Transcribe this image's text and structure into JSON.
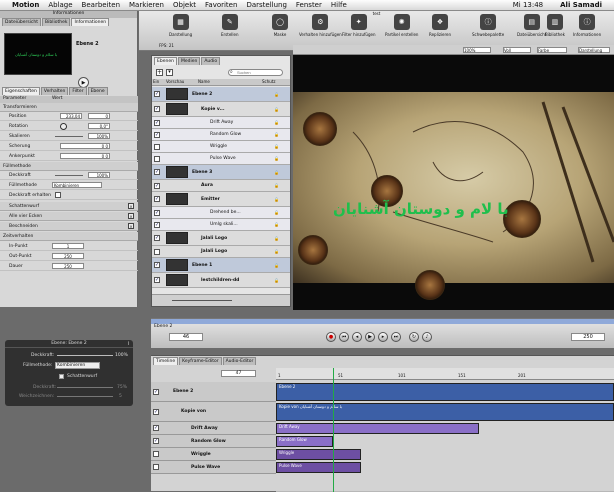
{
  "menubar": {
    "apple": "",
    "items": [
      "Motion",
      "Ablage",
      "Bearbeiten",
      "Markieren",
      "Objekt",
      "Favoriten",
      "Darstellung",
      "Fenster",
      "Hilfe"
    ],
    "clock": "Mi 13:48",
    "user": "Ali Samadi"
  },
  "toolbar": {
    "buttons": [
      {
        "label": "Darstellung",
        "icon": "view-icon"
      },
      {
        "label": "Erstellen",
        "icon": "create-icon"
      },
      {
        "label": "Maske",
        "icon": "mask-icon"
      },
      {
        "label": "Verhalten hinzufügen",
        "icon": "behavior-icon"
      },
      {
        "label": "Filter hinzufügen",
        "icon": "filter-icon"
      },
      {
        "label": "Partikel erstellen",
        "icon": "particle-icon"
      },
      {
        "label": "Replizieren",
        "icon": "replicate-icon"
      },
      {
        "label": "Schwebepalette",
        "icon": "hud-icon"
      },
      {
        "label": "Dateiübersicht",
        "icon": "file-browser-icon"
      },
      {
        "label": "Bibliothek",
        "icon": "library-icon"
      },
      {
        "label": "Informationen",
        "icon": "inspector-icon"
      }
    ],
    "window_title": "test",
    "zoom": "100%",
    "view_mode": "Voll",
    "color_mode": "Farbe",
    "display": "Darstellung",
    "fps": "FPS: 21"
  },
  "inspector": {
    "title": "Informationen",
    "top_tabs": [
      "Dateiübersicht",
      "Bibliothek",
      "Informationen"
    ],
    "layer_name": "Ebene 2",
    "preview_text": "با سلام و دوستان آشنایان",
    "sub_tabs": [
      "Eigenschaften",
      "Verhalten",
      "Filter",
      "Ebene"
    ],
    "col_param": "Parameter",
    "col_value": "Wert",
    "sections": {
      "transform": "Transformieren",
      "position": "Position",
      "position_x": "233,04",
      "position_y": "0",
      "rotation": "Rotation",
      "rotation_val": "0,0°",
      "scale": "Skalieren",
      "scale_val": "100%",
      "shear": "Scherung",
      "shear_val": "0 0",
      "anchor": "Ankerpunkt",
      "anchor_val": "0 0",
      "blend": "Füllmethode",
      "opacity": "Deckkraft",
      "opacity_val": "100%",
      "blend_mode": "Füllmethode",
      "blend_mode_val": "Kombinieren",
      "preserve_opacity": "Deckkraft erhalten",
      "drop_shadow": "Schattenwurf",
      "four_corner": "Alle vier Ecken",
      "crop": "Beschneiden",
      "timing": "Zeitverhalten",
      "in_point": "In-Punkt",
      "in_val": "1",
      "out_point": "Out-Punkt",
      "out_val": "250",
      "duration": "Dauer",
      "duration_val": "250"
    }
  },
  "hud": {
    "title": "Ebene: Ebene 2",
    "opacity_label": "Deckkraft:",
    "opacity_val": "100%",
    "blend_label": "Füllmethode:",
    "blend_val": "Kombinieren",
    "shadow_label": "Schattenwurf",
    "opacity2_label": "Deckkraft:",
    "opacity2_val": "75%",
    "soft_label": "Weichzeichnen:",
    "soft_val": "5"
  },
  "layers": {
    "tabs": [
      "Ebenen",
      "Medien",
      "Audio"
    ],
    "search_placeholder": "Suchen",
    "columns": [
      "Ein",
      "Vorschau",
      "Name",
      "Schutz"
    ],
    "rows": [
      {
        "name": "Ebene 2",
        "level": 0,
        "checked": true,
        "thumb": true,
        "group": true
      },
      {
        "name": "Kopie v...",
        "level": 1,
        "checked": true,
        "thumb": true,
        "group": false
      },
      {
        "name": "Drift Away",
        "level": 2,
        "checked": true,
        "thumb": false,
        "group": false
      },
      {
        "name": "Random Glow",
        "level": 2,
        "checked": true,
        "thumb": false,
        "group": false
      },
      {
        "name": "Wriggle",
        "level": 2,
        "checked": false,
        "thumb": false,
        "group": false
      },
      {
        "name": "Pulse Wave",
        "level": 2,
        "checked": false,
        "thumb": false,
        "group": false
      },
      {
        "name": "Ebene 3",
        "level": 0,
        "checked": true,
        "thumb": true,
        "group": true
      },
      {
        "name": "Aura",
        "level": 1,
        "checked": true,
        "thumb": false,
        "group": false
      },
      {
        "name": "Emitter",
        "level": 1,
        "checked": true,
        "thumb": true,
        "group": false
      },
      {
        "name": "Drehend be...",
        "level": 2,
        "checked": true,
        "thumb": false,
        "group": false
      },
      {
        "name": "Umlg skali...",
        "level": 2,
        "checked": true,
        "thumb": false,
        "group": false
      },
      {
        "name": "Jalali Logo",
        "level": 1,
        "checked": true,
        "thumb": true,
        "group": false
      },
      {
        "name": "Jalali Logo",
        "level": 1,
        "checked": false,
        "thumb": false,
        "group": false
      },
      {
        "name": "Ebene 1",
        "level": 0,
        "checked": true,
        "thumb": true,
        "group": true
      },
      {
        "name": "lestchildren-dd",
        "level": 1,
        "checked": true,
        "thumb": true,
        "group": false
      }
    ]
  },
  "canvas": {
    "arabic_text": "با لام و دوستان آشنایان"
  },
  "transport": {
    "layer_label": "Ebene 2",
    "current_frame": "46",
    "end_frame": "250"
  },
  "timeline": {
    "tabs": [
      "Timeline",
      "Keyframe-Editor",
      "Audio-Editor"
    ],
    "frame": "47",
    "ruler": [
      "1",
      "51",
      "101",
      "151",
      "201"
    ],
    "tracks": [
      {
        "name": "Ebene 2",
        "bar": "Ebene 2",
        "color": "#3c5fa6",
        "start": 0,
        "end": 1
      },
      {
        "name": "Kopie von",
        "bar": "Kopie von  با سلام و دوستان آشنایان",
        "color": "#3c5fa6",
        "start": 0,
        "end": 1
      },
      {
        "name": "Drift Away",
        "bar": "Drift Away",
        "color": "#8a6fc7",
        "start": 0,
        "end": 0.6
      },
      {
        "name": "Random Glow",
        "bar": "Random Glow",
        "color": "#8a6fc7",
        "start": 0,
        "end": 0.17
      },
      {
        "name": "Wriggle",
        "bar": "Wriggle",
        "color": "#6d4fa3",
        "start": 0,
        "end": 0.25
      },
      {
        "name": "Pulse Wave",
        "bar": "Pulse Wave",
        "color": "#6d4fa3",
        "start": 0,
        "end": 0.25
      }
    ],
    "subrow_text": "با سلام و دوستان آشنایان"
  },
  "colors": {
    "accent": "#3c5fa6",
    "behavior": "#8a6fc7",
    "text_green": "#1fbf4c"
  }
}
